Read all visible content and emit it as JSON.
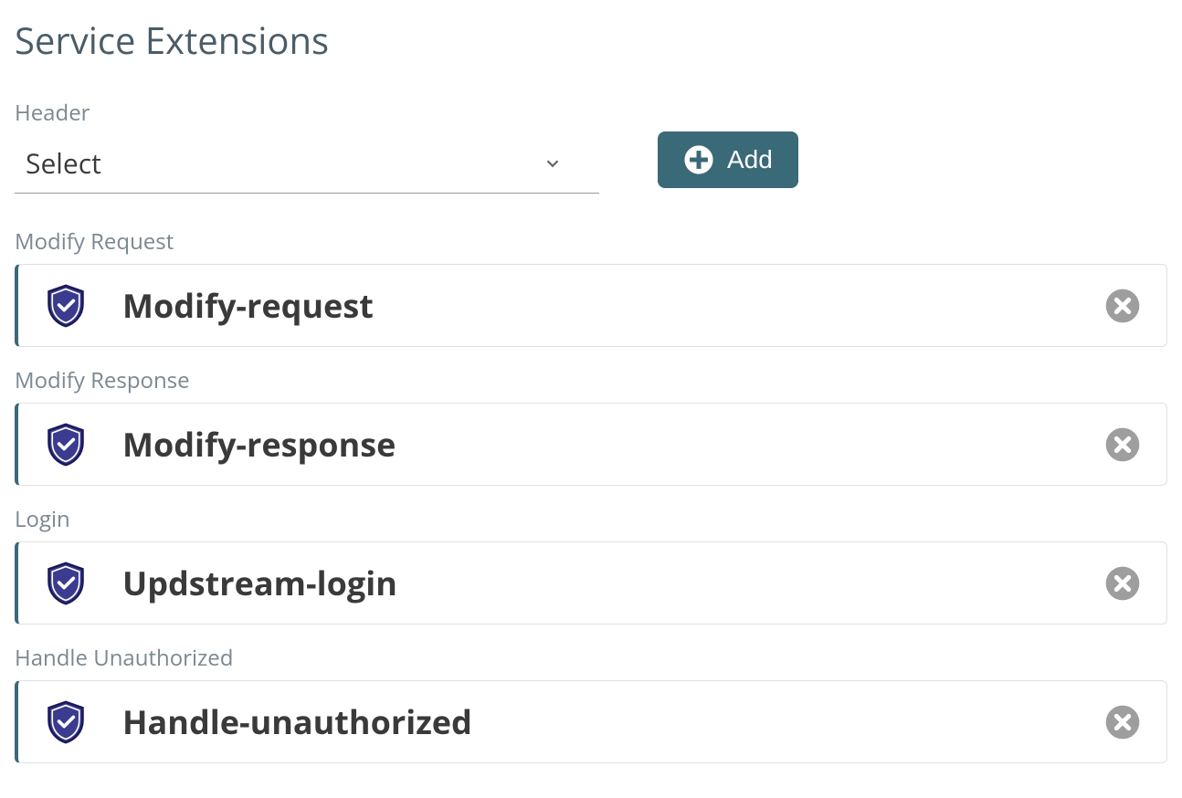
{
  "page": {
    "title": "Service Extensions"
  },
  "header_field": {
    "label": "Header",
    "selected_value": "Select"
  },
  "add_button": {
    "label": "Add"
  },
  "sections": {
    "modify_request": {
      "label": "Modify Request",
      "item": {
        "name": "Modify-request"
      }
    },
    "modify_response": {
      "label": "Modify Response",
      "item": {
        "name": "Modify-response"
      }
    },
    "login": {
      "label": "Login",
      "item": {
        "name": "Updstream-login"
      }
    },
    "handle_unauthorized": {
      "label": "Handle Unauthorized",
      "item": {
        "name": "Handle-unauthorized"
      }
    }
  },
  "colors": {
    "accent": "#3a6978",
    "shield_fill": "#3b3b8f",
    "shield_stroke": "#1a1a5a",
    "remove_icon": "#9e9e9e"
  }
}
